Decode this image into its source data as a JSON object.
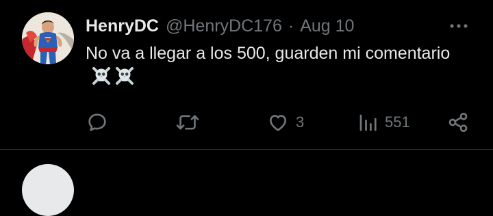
{
  "tweet": {
    "display_name": "HenryDC",
    "handle": "@HenryDC176",
    "separator": "·",
    "date": "Aug 10",
    "text": "No va a llegar a los 500, guarden mi comentario",
    "emojis": [
      "skull-and-crossbones",
      "skull-and-crossbones"
    ],
    "actions": {
      "reply_count": "",
      "retweet_count": "",
      "like_count": "3",
      "views_count": "551"
    }
  },
  "colors": {
    "background": "#000000",
    "primary_text": "#e7e9ea",
    "secondary_text": "#71767b",
    "divider": "#2f3336"
  }
}
